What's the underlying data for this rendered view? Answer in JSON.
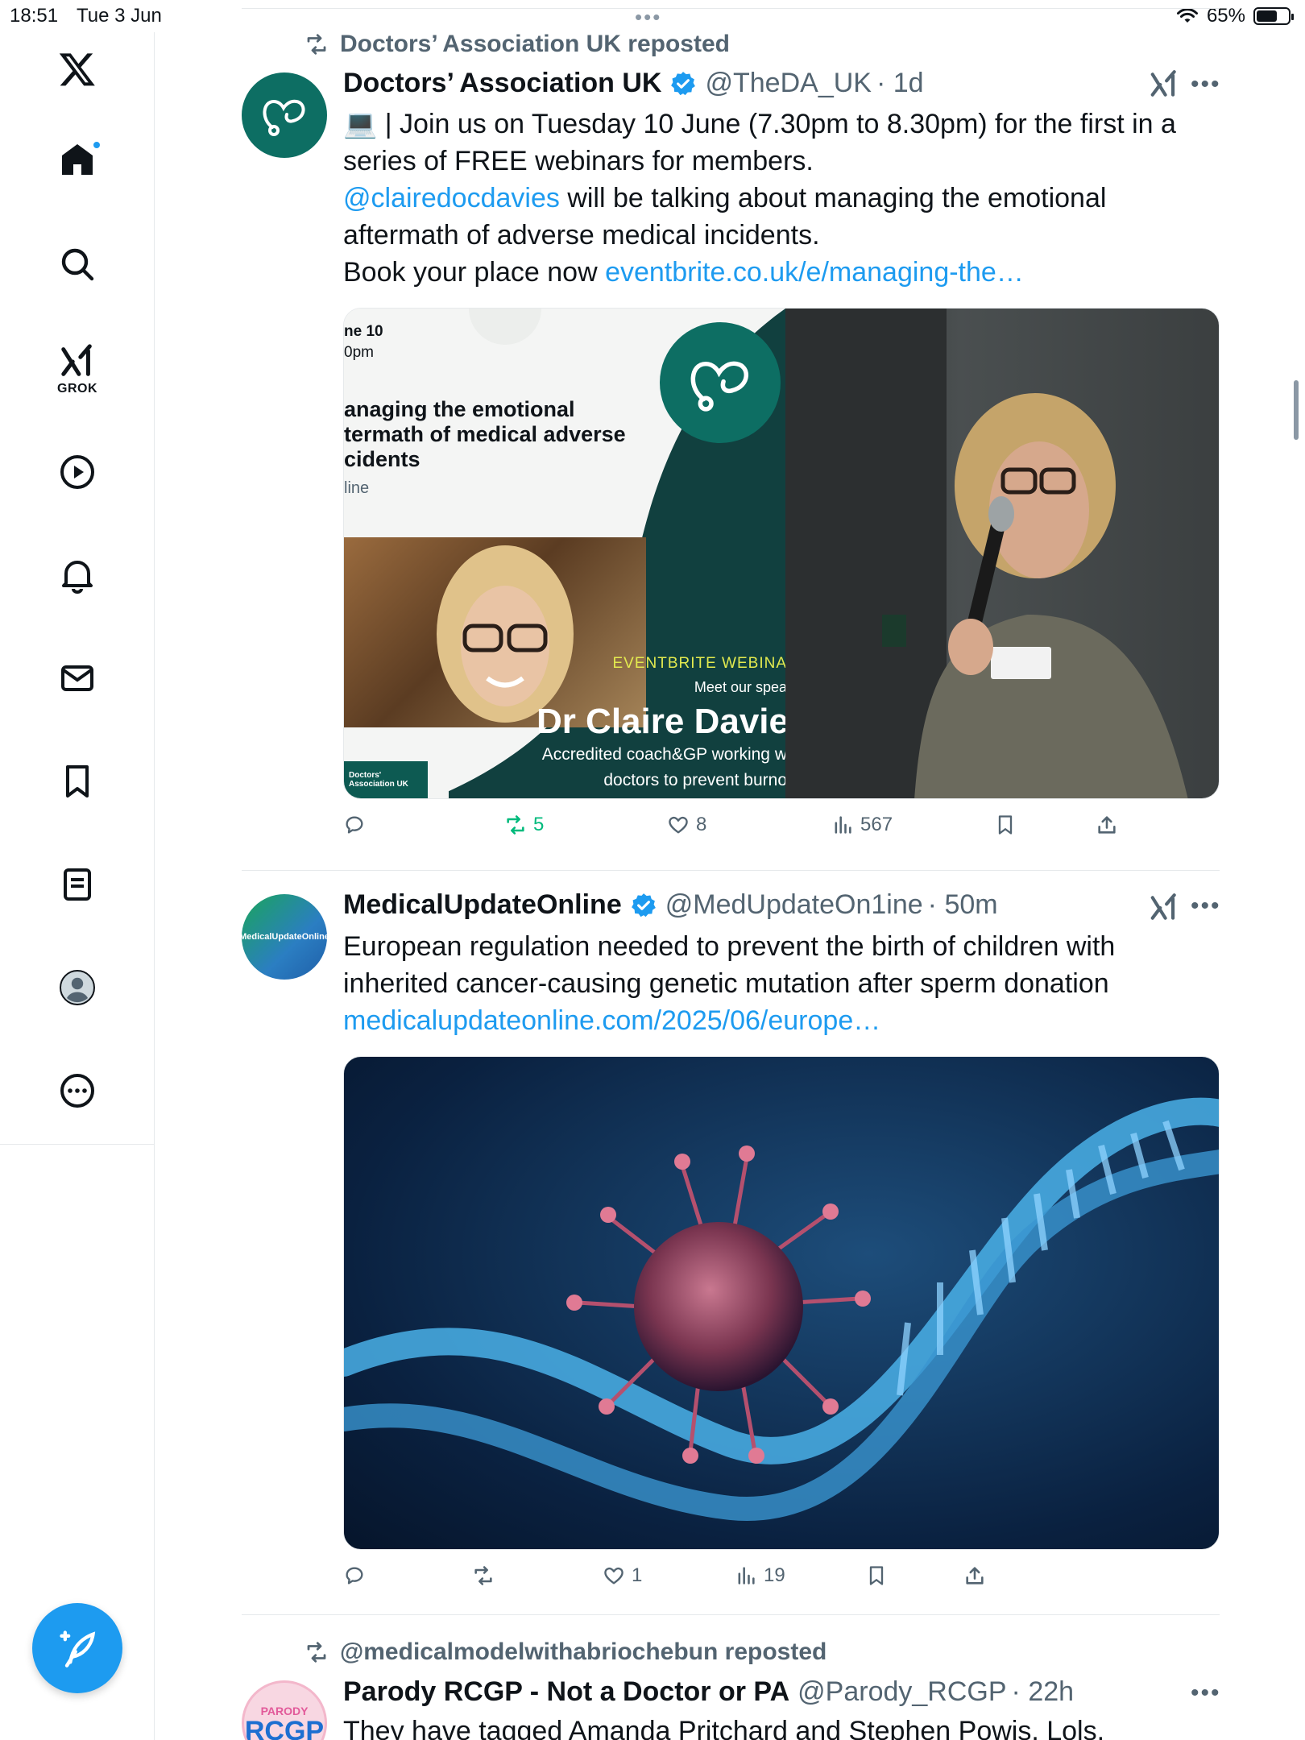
{
  "status_bar": {
    "time": "18:51",
    "date": "Tue 3 Jun",
    "dots": "•••",
    "battery": "65%",
    "battery_level": 0.65
  },
  "sidebar": {
    "grok_label": "GROK",
    "icons": [
      "x-logo-icon",
      "home-icon",
      "search-icon",
      "grok-icon",
      "video-icon",
      "bell-icon",
      "mail-icon",
      "bookmark-icon",
      "list-icon",
      "profile-icon",
      "more-icon"
    ]
  },
  "tweets": [
    {
      "repost_by": "Doctors’ Association UK reposted",
      "name": "Doctors’ Association UK",
      "handle": "@TheDA_UK",
      "time": "· 1d",
      "text_line1": "💻 | Join us on Tuesday 10 June (7.30pm to 8.30pm) for the first in a series of FREE webinars for members.",
      "mention": "@clairedocdavies",
      "text_line2": " will be talking about managing the emotional aftermath of adverse medical incidents.",
      "text_line3": "Book your place now ",
      "link": "eventbrite.co.uk/e/managing-the…",
      "media": {
        "date_frag1": "ne 10",
        "date_frag2": "0pm",
        "title1": "anaging the emotional",
        "title2": "termath of medical adverse",
        "title3": "cidents",
        "online": "line",
        "eventbrite": "EVENTBRITE WEBINA",
        "meet": "Meet our spea",
        "speaker": "Dr Claire Davie",
        "desc1": "Accredited coach&GP working w",
        "desc2": "doctors to prevent burno",
        "logo_text": "Doctors' Association UK"
      },
      "stats": {
        "replies": "",
        "reposts": "5",
        "likes": "8",
        "views": "567"
      }
    },
    {
      "name": "MedicalUpdateOnline",
      "handle": "@MedUpdateOn1ine",
      "time": "· 50m",
      "avatar_text": "MedicalUpdateOnline",
      "text": "European regulation needed to prevent the birth of children with inherited cancer-causing genetic mutation after sperm donation",
      "link": "medicalupdateonline.com/2025/06/europe…",
      "stats": {
        "replies": "",
        "reposts": "",
        "likes": "1",
        "views": "19"
      }
    },
    {
      "repost_by": "@medicalmodelwithabriochebun reposted",
      "name": "Parody RCGP - Not a Doctor or PA",
      "handle": "@Parody_RCGP",
      "time": "· 22h",
      "avatar_top": "PARODY",
      "avatar_main": "RCGP",
      "text": "They have tagged Amanda Pritchard and Stephen Powis. Lols."
    }
  ],
  "colors": {
    "accent": "#1d9bf0",
    "repost_green": "#00ba7c",
    "secondary_text": "#536471",
    "daa_teal": "#0d6e63",
    "daa_dark": "#11403f"
  }
}
